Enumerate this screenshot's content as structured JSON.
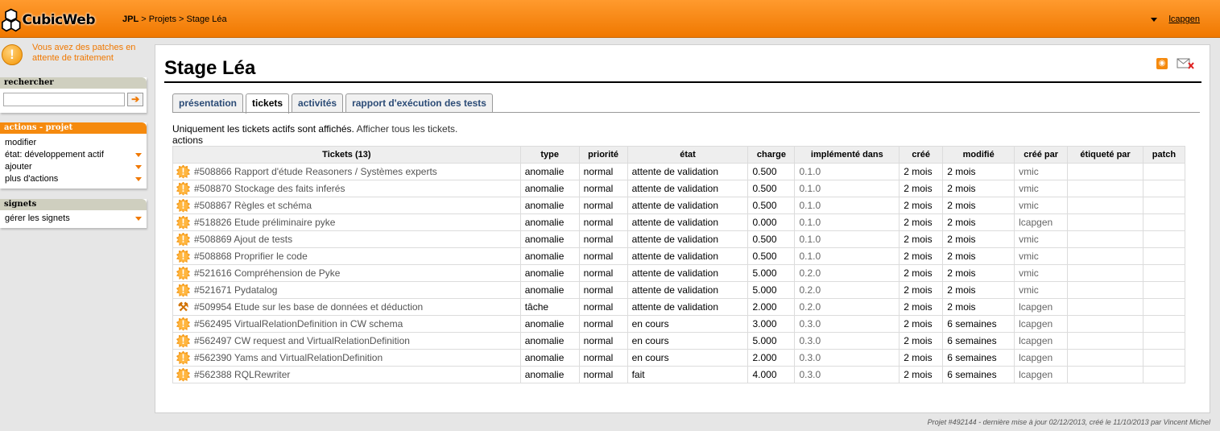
{
  "header": {
    "logo_text": "CubicWeb",
    "breadcrumb": {
      "root": "JPL",
      "rest": " > Projets > Stage Léa"
    },
    "user": "lcapgen"
  },
  "sidebar": {
    "notice": "Vous avez des patches en attente de traitement",
    "search": {
      "title": "rechercher",
      "value": ""
    },
    "actions": {
      "title": "actions - projet",
      "items": [
        {
          "label": "modifier",
          "has_menu": false
        },
        {
          "label": "état: développement actif",
          "has_menu": true
        },
        {
          "label": "ajouter",
          "has_menu": true
        },
        {
          "label": "plus d'actions",
          "has_menu": true
        }
      ]
    },
    "signets": {
      "title": "signets",
      "items": [
        {
          "label": "gérer les signets",
          "has_menu": true
        }
      ]
    }
  },
  "main": {
    "title": "Stage Léa",
    "tabs": [
      {
        "label": "présentation",
        "active": false
      },
      {
        "label": "tickets",
        "active": true
      },
      {
        "label": "activités",
        "active": false
      },
      {
        "label": "rapport d'exécution des tests",
        "active": false
      }
    ],
    "info": "Uniquement les tickets actifs sont affichés.",
    "show_all": "Afficher tous les tickets.",
    "actions_label": "actions",
    "table": {
      "headers": [
        "Tickets (13)",
        "type",
        "priorité",
        "état",
        "charge",
        "implémenté dans",
        "créé",
        "modifié",
        "créé par",
        "étiqueté par",
        "patch"
      ],
      "rows": [
        {
          "icon": "bug-icon",
          "ticket": "#508866 Rapport d'étude Reasoners / Systèmes experts",
          "type": "anomalie",
          "priority": "normal",
          "state": "attente de validation",
          "charge": "0.500",
          "version": "0.1.0",
          "created": "2 mois",
          "modified": "2 mois",
          "creator": "vmic",
          "tagged": "",
          "patch": ""
        },
        {
          "icon": "bug-icon",
          "ticket": "#508870 Stockage des faits inferés",
          "type": "anomalie",
          "priority": "normal",
          "state": "attente de validation",
          "charge": "0.500",
          "version": "0.1.0",
          "created": "2 mois",
          "modified": "2 mois",
          "creator": "vmic",
          "tagged": "",
          "patch": ""
        },
        {
          "icon": "bug-icon",
          "ticket": "#508867 Règles et schéma",
          "type": "anomalie",
          "priority": "normal",
          "state": "attente de validation",
          "charge": "0.500",
          "version": "0.1.0",
          "created": "2 mois",
          "modified": "2 mois",
          "creator": "vmic",
          "tagged": "",
          "patch": ""
        },
        {
          "icon": "bug-icon",
          "ticket": "#518826 Etude préliminaire pyke",
          "type": "anomalie",
          "priority": "normal",
          "state": "attente de validation",
          "charge": "0.000",
          "version": "0.1.0",
          "created": "2 mois",
          "modified": "2 mois",
          "creator": "lcapgen",
          "tagged": "",
          "patch": ""
        },
        {
          "icon": "bug-icon",
          "ticket": "#508869 Ajout de tests",
          "type": "anomalie",
          "priority": "normal",
          "state": "attente de validation",
          "charge": "0.500",
          "version": "0.1.0",
          "created": "2 mois",
          "modified": "2 mois",
          "creator": "vmic",
          "tagged": "",
          "patch": ""
        },
        {
          "icon": "bug-icon",
          "ticket": "#508868 Proprifier le code",
          "type": "anomalie",
          "priority": "normal",
          "state": "attente de validation",
          "charge": "0.500",
          "version": "0.1.0",
          "created": "2 mois",
          "modified": "2 mois",
          "creator": "vmic",
          "tagged": "",
          "patch": ""
        },
        {
          "icon": "bug-icon",
          "ticket": "#521616 Compréhension de Pyke",
          "type": "anomalie",
          "priority": "normal",
          "state": "attente de validation",
          "charge": "5.000",
          "version": "0.2.0",
          "created": "2 mois",
          "modified": "2 mois",
          "creator": "vmic",
          "tagged": "",
          "patch": ""
        },
        {
          "icon": "bug-icon",
          "ticket": "#521671 Pydatalog",
          "type": "anomalie",
          "priority": "normal",
          "state": "attente de validation",
          "charge": "5.000",
          "version": "0.2.0",
          "created": "2 mois",
          "modified": "2 mois",
          "creator": "vmic",
          "tagged": "",
          "patch": ""
        },
        {
          "icon": "task-icon",
          "ticket": "#509954 Etude sur les base de données et déduction",
          "type": "tâche",
          "priority": "normal",
          "state": "attente de validation",
          "charge": "2.000",
          "version": "0.2.0",
          "created": "2 mois",
          "modified": "2 mois",
          "creator": "lcapgen",
          "tagged": "",
          "patch": ""
        },
        {
          "icon": "bug-icon",
          "ticket": "#562495 VirtualRelationDefinition in CW schema",
          "type": "anomalie",
          "priority": "normal",
          "state": "en cours",
          "charge": "3.000",
          "version": "0.3.0",
          "created": "2 mois",
          "modified": "6 semaines",
          "creator": "lcapgen",
          "tagged": "",
          "patch": ""
        },
        {
          "icon": "bug-icon",
          "ticket": "#562497 CW request and VirtualRelationDefinition",
          "type": "anomalie",
          "priority": "normal",
          "state": "en cours",
          "charge": "5.000",
          "version": "0.3.0",
          "created": "2 mois",
          "modified": "6 semaines",
          "creator": "lcapgen",
          "tagged": "",
          "patch": ""
        },
        {
          "icon": "bug-icon",
          "ticket": "#562390 Yams and VirtualRelationDefinition",
          "type": "anomalie",
          "priority": "normal",
          "state": "en cours",
          "charge": "2.000",
          "version": "0.3.0",
          "created": "2 mois",
          "modified": "6 semaines",
          "creator": "lcapgen",
          "tagged": "",
          "patch": ""
        },
        {
          "icon": "bug-icon",
          "ticket": "#562388 RQLRewriter",
          "type": "anomalie",
          "priority": "normal",
          "state": "fait",
          "charge": "4.000",
          "version": "0.3.0",
          "created": "2 mois",
          "modified": "6 semaines",
          "creator": "lcapgen",
          "tagged": "",
          "patch": ""
        }
      ]
    }
  },
  "footer": "Projet #492144 - dernière mise à jour 02/12/2013, créé le 11/10/2013 par Vincent Michel",
  "colors": {
    "accent": "#f07800",
    "link": "#2b4b76"
  }
}
